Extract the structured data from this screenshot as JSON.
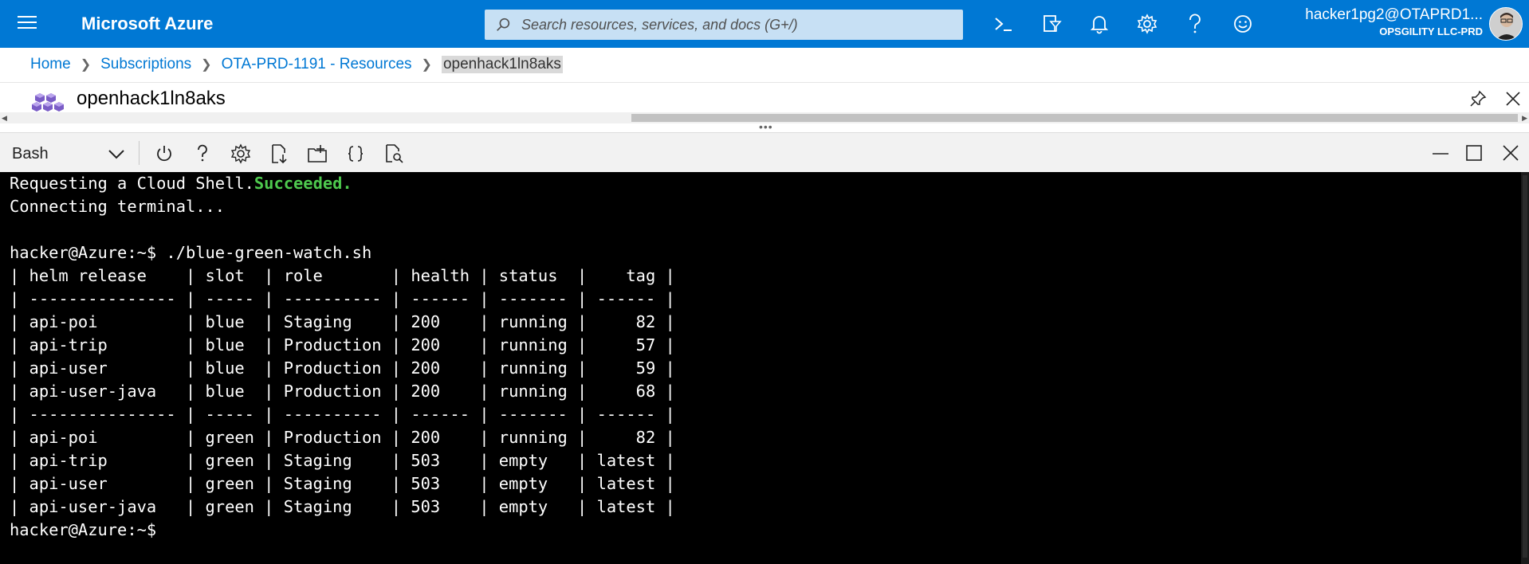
{
  "topbar": {
    "brand": "Microsoft Azure",
    "search_placeholder": "Search resources, services, and docs (G+/)",
    "icons": [
      "cloud-shell-icon",
      "directory-filter-icon",
      "notifications-icon",
      "settings-icon",
      "help-icon",
      "feedback-icon"
    ],
    "account_name": "hacker1pg2@OTAPRD1...",
    "account_org": "OPSGILITY LLC-PRD"
  },
  "breadcrumb": {
    "items": [
      "Home",
      "Subscriptions",
      "OTA-PRD-1191 - Resources"
    ],
    "current": "openhack1ln8aks"
  },
  "resource": {
    "title": "openhack1ln8aks"
  },
  "shell": {
    "shell_type": "Bash",
    "toolbar_icons": [
      "restart-icon",
      "help-icon",
      "settings-icon",
      "upload-download-icon",
      "open-new-session-icon",
      "editor-icon",
      "web-preview-icon"
    ],
    "terminal": {
      "line0_prefix": "Requesting a Cloud Shell.",
      "line0_status": "Succeeded.",
      "lines": [
        "Connecting terminal...",
        "",
        "hacker@Azure:~$ ./blue-green-watch.sh",
        "| helm release    | slot  | role       | health | status  |    tag |",
        "| --------------- | ----- | ---------- | ------ | ------- | ------ |",
        "| api-poi         | blue  | Staging    | 200    | running |     82 |",
        "| api-trip        | blue  | Production | 200    | running |     57 |",
        "| api-user        | blue  | Production | 200    | running |     59 |",
        "| api-user-java   | blue  | Production | 200    | running |     68 |",
        "| --------------- | ----- | ---------- | ------ | ------- | ------ |",
        "| api-poi         | green | Production | 200    | running |     82 |",
        "| api-trip        | green | Staging    | 503    | empty   | latest |",
        "| api-user        | green | Staging    | 503    | empty   | latest |",
        "| api-user-java   | green | Staging    | 503    | empty   | latest |",
        "hacker@Azure:~$ "
      ]
    }
  },
  "colors": {
    "azure_blue": "#0078d4",
    "search_bg": "#c7e0f4",
    "terminal_bg": "#000000",
    "success_green": "#4ec94e"
  }
}
